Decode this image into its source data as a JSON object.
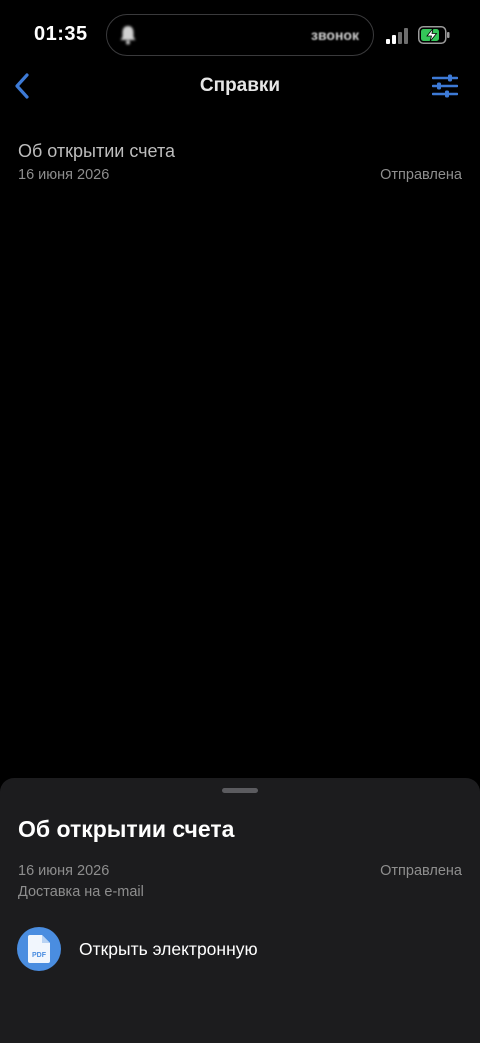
{
  "status_bar": {
    "time": "01:35",
    "island_text": "звонок",
    "colors": {
      "battery": "#34c759"
    }
  },
  "nav": {
    "title": "Справки",
    "back_icon": "chevron-left-icon",
    "filter_icon": "filter-sliders-icon",
    "accent": "#3d7ad6"
  },
  "list": {
    "items": [
      {
        "title": "Об открытии счета",
        "date": "16 июня 2026",
        "status": "Отправлена"
      }
    ]
  },
  "sheet": {
    "title": "Об открытии счета",
    "date": "16 июня 2026",
    "status": "Отправлена",
    "delivery": "Доставка на e-mail",
    "action": {
      "label": "Открыть электронную",
      "icon": "pdf-file-icon",
      "icon_text": "PDF"
    }
  }
}
